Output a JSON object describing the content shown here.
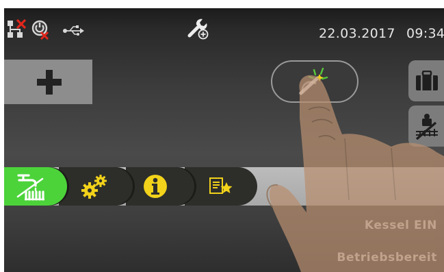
{
  "status_bar": {
    "date": "22.03.2017",
    "time": "09:34",
    "icons": [
      "network-disconnected-icon",
      "power-standby-icon",
      "usb-icon",
      "service-wrench-icon"
    ]
  },
  "controls": {
    "add_button_icon": "plus-icon",
    "center_button_icon": "magic-wand-icon",
    "side_buttons": [
      "briefcase-icon",
      "chimney-sweep-icon"
    ]
  },
  "tabs": [
    {
      "icon": "hot-water-radiator-icon",
      "active": true
    },
    {
      "icon": "settings-gears-icon",
      "active": false
    },
    {
      "icon": "info-icon",
      "active": false
    },
    {
      "icon": "favorites-list-icon",
      "active": false
    }
  ],
  "status": {
    "boiler": "Kessel EIN",
    "state": "Betriebsbereit"
  },
  "colors": {
    "active_tab": "#4cd33a",
    "tab_dark": "#2d2e2a",
    "accent_yellow": "#f2d21a"
  }
}
